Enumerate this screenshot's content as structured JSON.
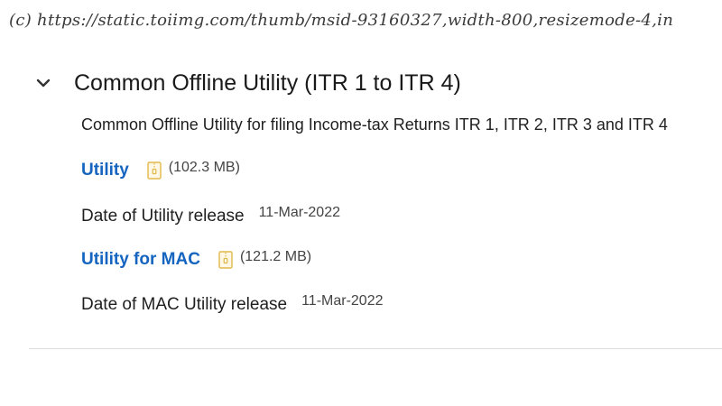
{
  "caption": "(c) https://static.toiimg.com/thumb/msid-93160327,width-800,resizemode-4,in",
  "section": {
    "title": "Common Offline Utility (ITR 1 to ITR 4)",
    "description": "Common Offline Utility for filing Income-tax Returns ITR 1, ITR 2, ITR 3 and ITR 4",
    "toggle_icon": "chevron-down-icon"
  },
  "utility": {
    "link_label": "Utility",
    "icon": "zip-file-icon",
    "size": "(102.3 MB)",
    "release_label": "Date of Utility release",
    "release_date": "11-Mar-2022"
  },
  "mac_utility": {
    "link_label": "Utility for MAC",
    "icon": "zip-file-icon",
    "size": "(121.2 MB)",
    "release_label": "Date of MAC Utility release",
    "release_date": "11-Mar-2022"
  },
  "colors": {
    "link": "#1565c0",
    "icon": "#e0b84a",
    "divider": "#dcdcdc"
  }
}
